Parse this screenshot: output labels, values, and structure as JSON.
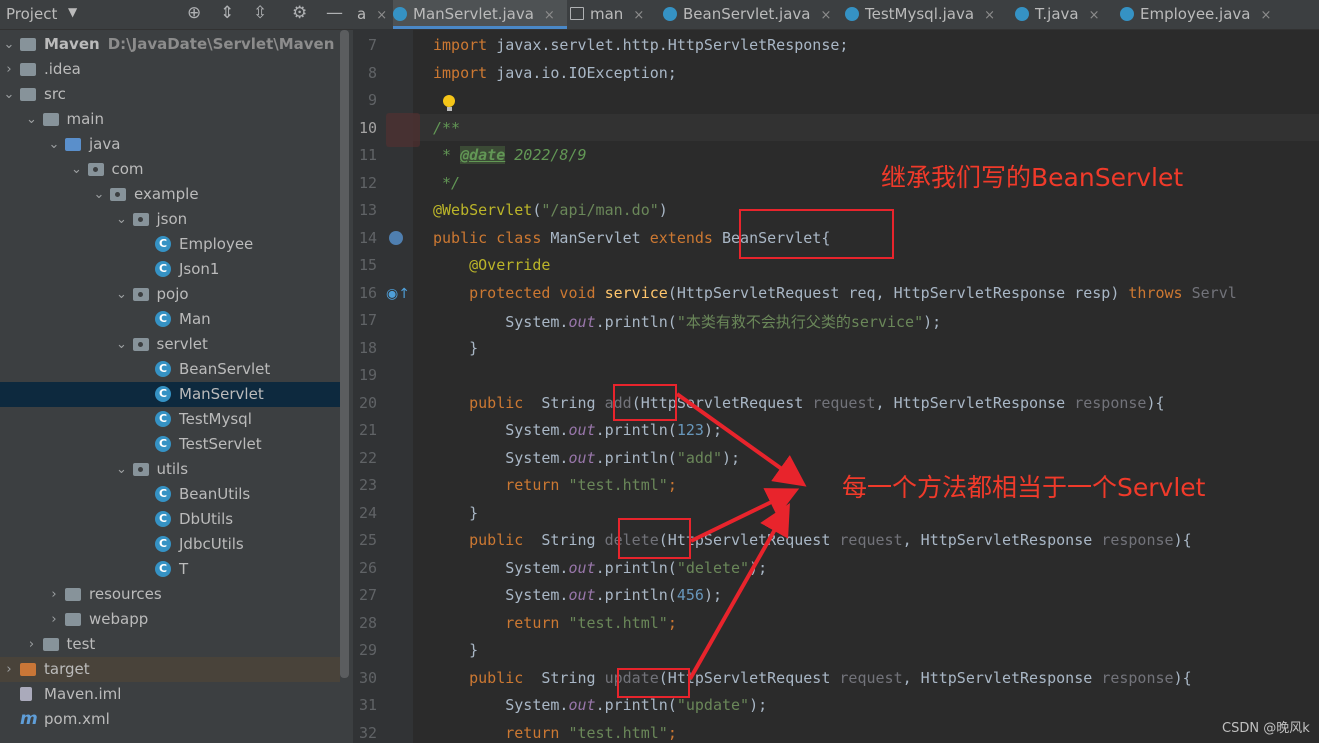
{
  "project_panel": {
    "title": "Project",
    "tree": [
      {
        "label": "Maven",
        "path": "D:\\JavaDate\\Servlet\\Maven",
        "indent": 0,
        "arrow": "down",
        "icon": "module"
      },
      {
        "label": ".idea",
        "indent": 0,
        "arrow": "right",
        "icon": "folder"
      },
      {
        "label": "src",
        "indent": 0,
        "arrow": "down",
        "icon": "folder"
      },
      {
        "label": "main",
        "indent": 1,
        "arrow": "down",
        "icon": "folder"
      },
      {
        "label": "java",
        "indent": 2,
        "arrow": "down",
        "icon": "folder-blue"
      },
      {
        "label": "com",
        "indent": 3,
        "arrow": "down",
        "icon": "package"
      },
      {
        "label": "example",
        "indent": 4,
        "arrow": "down",
        "icon": "package"
      },
      {
        "label": "json",
        "indent": 5,
        "arrow": "down",
        "icon": "package"
      },
      {
        "label": "Employee",
        "indent": 6,
        "arrow": "",
        "icon": "class"
      },
      {
        "label": "Json1",
        "indent": 6,
        "arrow": "",
        "icon": "class"
      },
      {
        "label": "pojo",
        "indent": 5,
        "arrow": "down",
        "icon": "package"
      },
      {
        "label": "Man",
        "indent": 6,
        "arrow": "",
        "icon": "class"
      },
      {
        "label": "servlet",
        "indent": 5,
        "arrow": "down",
        "icon": "package"
      },
      {
        "label": "BeanServlet",
        "indent": 6,
        "arrow": "",
        "icon": "class"
      },
      {
        "label": "ManServlet",
        "indent": 6,
        "arrow": "",
        "icon": "class",
        "selected": true
      },
      {
        "label": "TestMysql",
        "indent": 6,
        "arrow": "",
        "icon": "class"
      },
      {
        "label": "TestServlet",
        "indent": 6,
        "arrow": "",
        "icon": "class"
      },
      {
        "label": "utils",
        "indent": 5,
        "arrow": "down",
        "icon": "package"
      },
      {
        "label": "BeanUtils",
        "indent": 6,
        "arrow": "",
        "icon": "class"
      },
      {
        "label": "DbUtils",
        "indent": 6,
        "arrow": "",
        "icon": "class"
      },
      {
        "label": "JdbcUtils",
        "indent": 6,
        "arrow": "",
        "icon": "class"
      },
      {
        "label": "T",
        "indent": 6,
        "arrow": "",
        "icon": "class"
      },
      {
        "label": "resources",
        "indent": 2,
        "arrow": "right",
        "icon": "folder"
      },
      {
        "label": "webapp",
        "indent": 2,
        "arrow": "right",
        "icon": "folder"
      },
      {
        "label": "test",
        "indent": 1,
        "arrow": "right",
        "icon": "folder"
      },
      {
        "label": "target",
        "indent": 0,
        "arrow": "right",
        "icon": "folder-orange",
        "highlight": true
      },
      {
        "label": "Maven.iml",
        "indent": 0,
        "arrow": "",
        "icon": "file"
      },
      {
        "label": "pom.xml",
        "indent": 0,
        "arrow": "",
        "icon": "maven"
      }
    ]
  },
  "tabs": [
    {
      "label": "a",
      "active": false,
      "icon": ""
    },
    {
      "label": "ManServlet.java",
      "active": true,
      "icon": "class"
    },
    {
      "label": "man",
      "active": false,
      "icon": "grid"
    },
    {
      "label": "BeanServlet.java",
      "active": false,
      "icon": "class"
    },
    {
      "label": "TestMysql.java",
      "active": false,
      "icon": "class"
    },
    {
      "label": "T.java",
      "active": false,
      "icon": "class"
    },
    {
      "label": "Employee.java",
      "active": false,
      "icon": "class"
    }
  ],
  "editor": {
    "line_numbers": [
      "7",
      "8",
      "9",
      "10",
      "11",
      "12",
      "13",
      "14",
      "15",
      "16",
      "17",
      "18",
      "19",
      "20",
      "21",
      "22",
      "23",
      "24",
      "25",
      "26",
      "27",
      "28",
      "29",
      "30",
      "31",
      "32"
    ],
    "current_line": "10",
    "lines": [
      [
        [
          "kw",
          "import "
        ],
        [
          "",
          "javax.servlet.http.HttpServletResponse;"
        ]
      ],
      [
        [
          "kw",
          "import "
        ],
        [
          "",
          "java.io.IOException;"
        ]
      ],
      [],
      [
        [
          "cmt",
          "/**"
        ]
      ],
      [
        [
          "cmt",
          " * "
        ],
        [
          "tag",
          "@date"
        ],
        [
          "cmt",
          " 2022/8/9"
        ]
      ],
      [
        [
          "cmt",
          " */"
        ]
      ],
      [
        [
          "ann",
          "@WebServlet"
        ],
        [
          "",
          "("
        ],
        [
          "str",
          "\"/api/man.do\""
        ],
        [
          "",
          ")"
        ]
      ],
      [
        [
          "kw",
          "public class "
        ],
        [
          "",
          "ManServlet "
        ],
        [
          "kw",
          "extends "
        ],
        [
          "",
          "BeanServlet{"
        ]
      ],
      [
        [
          "",
          "    "
        ],
        [
          "ann",
          "@Override"
        ]
      ],
      [
        [
          "",
          "    "
        ],
        [
          "kw",
          "protected void "
        ],
        [
          "mth",
          "service"
        ],
        [
          "",
          "(HttpServletRequest req, HttpServletResponse resp) "
        ],
        [
          "kw",
          "throws "
        ],
        [
          "gray",
          "Servl"
        ]
      ],
      [
        [
          "",
          "        System."
        ],
        [
          "fld",
          "out"
        ],
        [
          "",
          ".println("
        ],
        [
          "str",
          "\"本类有救不会执行父类的service\""
        ],
        [
          "",
          ");"
        ]
      ],
      [
        [
          "",
          "    }"
        ]
      ],
      [],
      [
        [
          "",
          "    "
        ],
        [
          "kw",
          "public  "
        ],
        [
          "",
          "String "
        ],
        [
          "gray",
          "add"
        ],
        [
          "",
          "(HttpServletRequest "
        ],
        [
          "gray",
          "request"
        ],
        [
          "",
          ", HttpServletResponse "
        ],
        [
          "gray",
          "response"
        ],
        [
          "",
          "){"
        ]
      ],
      [
        [
          "",
          "        System."
        ],
        [
          "fld",
          "out"
        ],
        [
          "",
          ".println("
        ],
        [
          "num",
          "123"
        ],
        [
          "",
          ");"
        ]
      ],
      [
        [
          "",
          "        System."
        ],
        [
          "fld",
          "out"
        ],
        [
          "",
          ".println("
        ],
        [
          "str",
          "\"add\""
        ],
        [
          "",
          ");"
        ]
      ],
      [
        [
          "",
          "        "
        ],
        [
          "kw",
          "return "
        ],
        [
          "str",
          "\"test.html\""
        ],
        [
          "kw",
          ";"
        ]
      ],
      [
        [
          "",
          "    }"
        ]
      ],
      [
        [
          "",
          "    "
        ],
        [
          "kw",
          "public  "
        ],
        [
          "",
          "String "
        ],
        [
          "gray",
          "delete"
        ],
        [
          "",
          "(HttpServletRequest "
        ],
        [
          "gray",
          "request"
        ],
        [
          "",
          ", HttpServletResponse "
        ],
        [
          "gray",
          "response"
        ],
        [
          "",
          "){"
        ]
      ],
      [
        [
          "",
          "        System."
        ],
        [
          "fld",
          "out"
        ],
        [
          "",
          ".println("
        ],
        [
          "str",
          "\"delete\""
        ],
        [
          "",
          ");"
        ]
      ],
      [
        [
          "",
          "        System."
        ],
        [
          "fld",
          "out"
        ],
        [
          "",
          ".println("
        ],
        [
          "num",
          "456"
        ],
        [
          "",
          ");"
        ]
      ],
      [
        [
          "",
          "        "
        ],
        [
          "kw",
          "return "
        ],
        [
          "str",
          "\"test.html\""
        ],
        [
          "kw",
          ";"
        ]
      ],
      [
        [
          "",
          "    }"
        ]
      ],
      [
        [
          "",
          "    "
        ],
        [
          "kw",
          "public  "
        ],
        [
          "",
          "String "
        ],
        [
          "gray",
          "update"
        ],
        [
          "",
          "(HttpServletRequest "
        ],
        [
          "gray",
          "request"
        ],
        [
          "",
          ", HttpServletResponse "
        ],
        [
          "gray",
          "response"
        ],
        [
          "",
          "){"
        ]
      ],
      [
        [
          "",
          "        System."
        ],
        [
          "fld",
          "out"
        ],
        [
          "",
          ".println("
        ],
        [
          "str",
          "\"update\""
        ],
        [
          "",
          ");"
        ]
      ],
      [
        [
          "",
          "        "
        ],
        [
          "kw",
          "return "
        ],
        [
          "str",
          "\"test.html\""
        ],
        [
          "kw",
          ";"
        ]
      ]
    ]
  },
  "annotations": {
    "inherit_note": "继承我们写的BeanServlet",
    "method_note": "每一个方法都相当于一个Servlet"
  },
  "watermark": "CSDN @晚风k",
  "colors": {
    "annotation_red": "#e8242c",
    "selection": "#0d293e",
    "editor_bg": "#2b2b2b",
    "panel_bg": "#3c3f41"
  }
}
